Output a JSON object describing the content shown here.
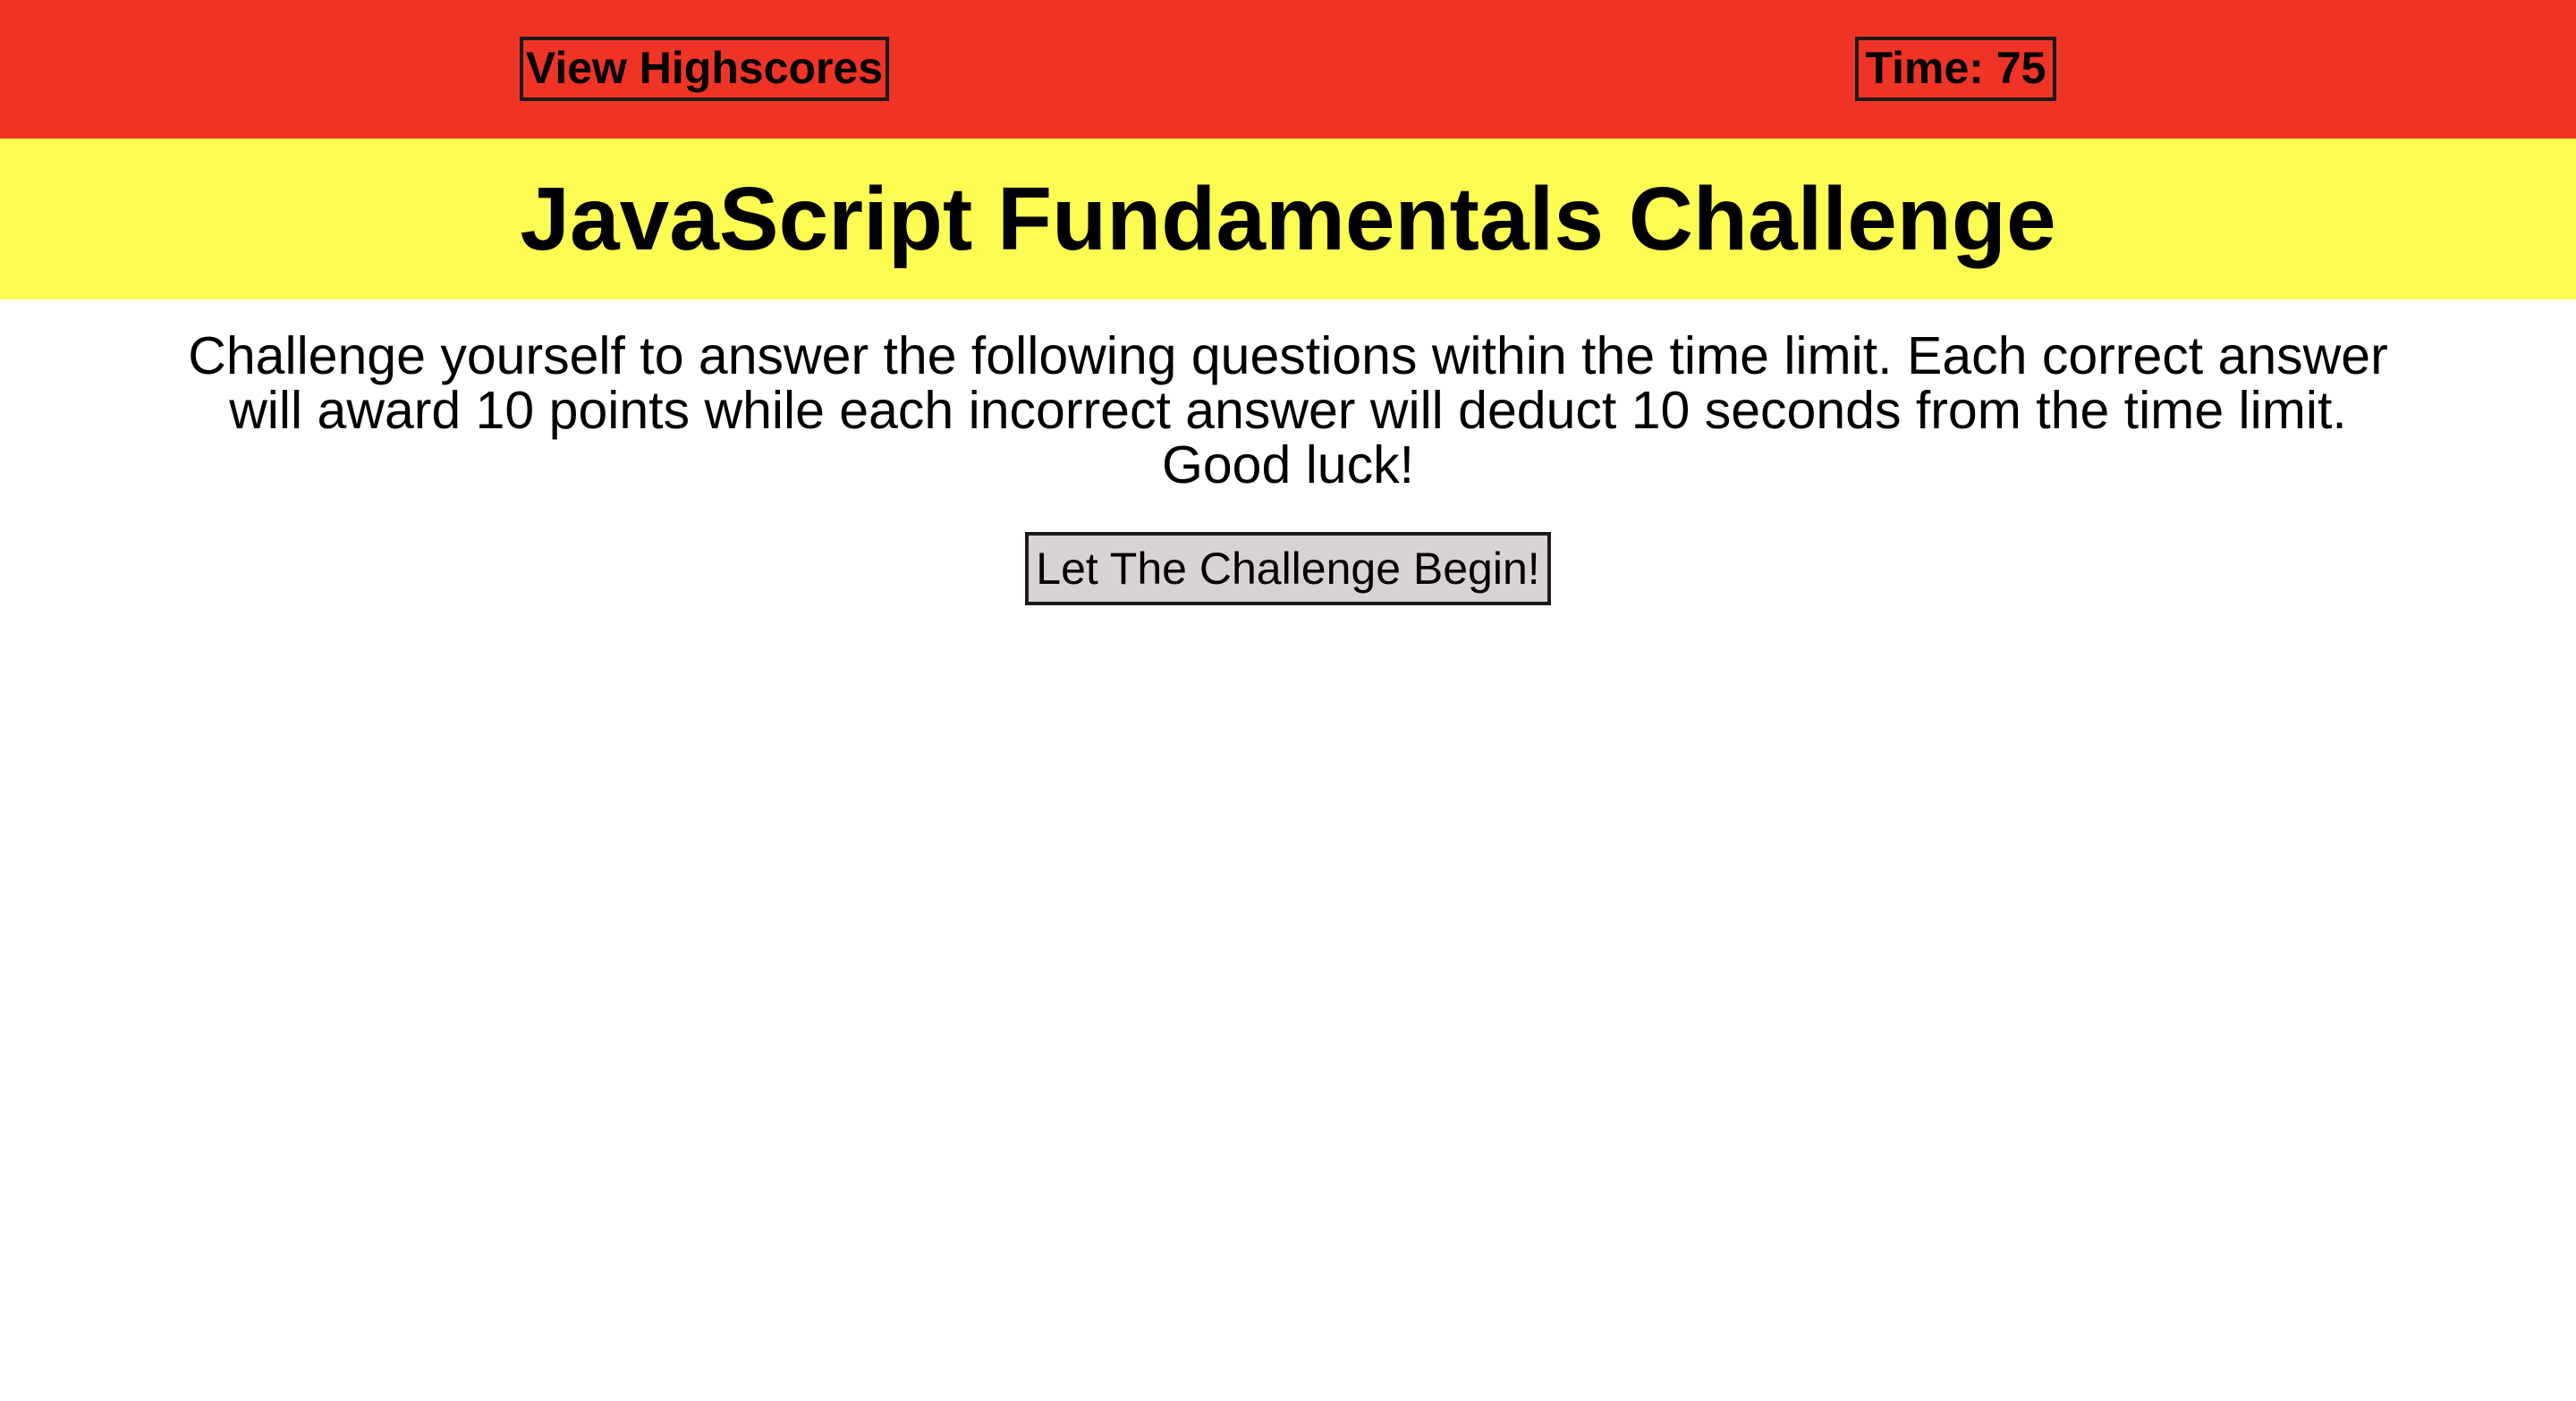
{
  "header": {
    "highscores_label": "View Highscores",
    "timer_label": "Time: 75"
  },
  "title_band": {
    "title": "JavaScript Fundamentals Challenge"
  },
  "main": {
    "intro": "Challenge yourself to answer the following questions within the time limit. Each correct answer will award 10 points while each incorrect answer will deduct 10 seconds from the time limit. Good luck!",
    "start_button_label": "Let The Challenge Begin!"
  },
  "colors": {
    "header_bg": "#ef3426",
    "title_band_bg": "#fdfc53",
    "button_bg": "#d9d2d2"
  }
}
